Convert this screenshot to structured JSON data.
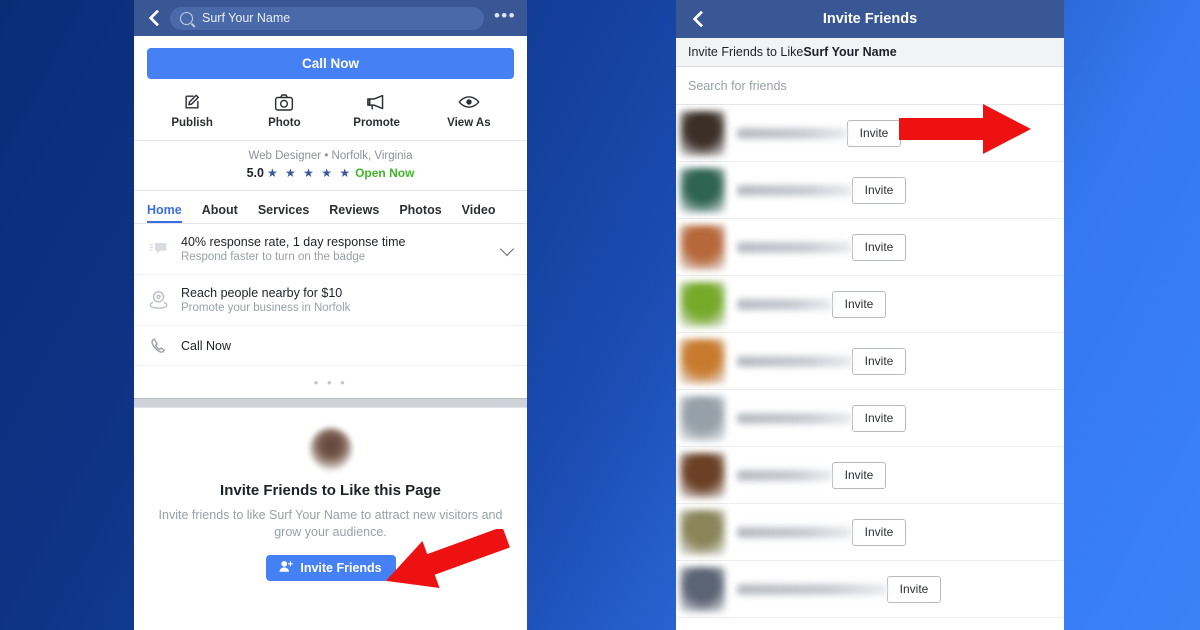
{
  "background": {
    "from": "#0a2d78",
    "to": "#3b82f7"
  },
  "left_phone": {
    "topbar": {
      "back_icon": "chevron-left-icon",
      "search_icon": "search-icon",
      "search_value": "Surf Your Name",
      "more_icon": "ellipsis-icon",
      "bg": "#3a5795"
    },
    "call_now_button": "Call Now",
    "actions": [
      {
        "label": "Publish",
        "icon": "publish-pencil-icon"
      },
      {
        "label": "Photo",
        "icon": "camera-icon"
      },
      {
        "label": "Promote",
        "icon": "megaphone-icon"
      },
      {
        "label": "View As",
        "icon": "eye-icon"
      }
    ],
    "business": {
      "category_location": "Web Designer • Norfolk, Virginia",
      "rating": "5.0",
      "stars": "★ ★ ★ ★ ★",
      "status": "Open Now",
      "status_color": "#42b72a"
    },
    "tabs": [
      {
        "label": "Home",
        "active": true
      },
      {
        "label": "About",
        "active": false
      },
      {
        "label": "Services",
        "active": false
      },
      {
        "label": "Reviews",
        "active": false
      },
      {
        "label": "Photos",
        "active": false
      },
      {
        "label": "Video",
        "active": false
      }
    ],
    "rows": [
      {
        "icon": "speech-bubble-icon",
        "title": "40% response rate, 1 day response time",
        "subtitle": "Respond faster to turn on the badge",
        "chevron": "chevron-down-icon"
      },
      {
        "icon": "location-pin-icon",
        "title": "Reach people nearby for $10",
        "subtitle": "Promote your business in Norfolk",
        "chevron": ""
      },
      {
        "icon": "phone-icon",
        "title": "Call Now",
        "subtitle": "",
        "chevron": ""
      }
    ],
    "more_dots": "• • •",
    "invite_card": {
      "avatar": "blurred-avatar",
      "title": "Invite Friends to Like this Page",
      "subtitle": "Invite friends to like Surf Your Name to attract new visitors and grow your audience.",
      "button_label": "Invite Friends",
      "button_icon": "add-person-icon",
      "button_color": "#4680f5"
    }
  },
  "right_phone": {
    "topbar": {
      "back_icon": "chevron-left-icon",
      "title": "Invite Friends",
      "bg": "#3a5795"
    },
    "subbar_prefix": "Invite Friends to Like ",
    "subbar_page_name": "Surf Your Name",
    "search_placeholder": "Search for friends",
    "invite_button_label": "Invite",
    "friends": [
      {
        "name": "",
        "avatar_color": "#3b2f27"
      },
      {
        "name": "",
        "avatar_color": "#2f6452"
      },
      {
        "name": "",
        "avatar_color": "#b7683a"
      },
      {
        "name": "",
        "avatar_color": "#77a92b"
      },
      {
        "name": "",
        "avatar_color": "#c87b2e"
      },
      {
        "name": "",
        "avatar_color": "#96a0a8"
      },
      {
        "name": "",
        "avatar_color": "#6b4025"
      },
      {
        "name": "",
        "avatar_color": "#8a8458"
      },
      {
        "name": "",
        "avatar_color": "#5b6474"
      }
    ]
  },
  "annotations": {
    "arrow_color": "#ee1111",
    "arrow_right": "arrow-pointing-to-invite-button",
    "arrow_left": "arrow-pointing-to-invite-friends-button"
  }
}
